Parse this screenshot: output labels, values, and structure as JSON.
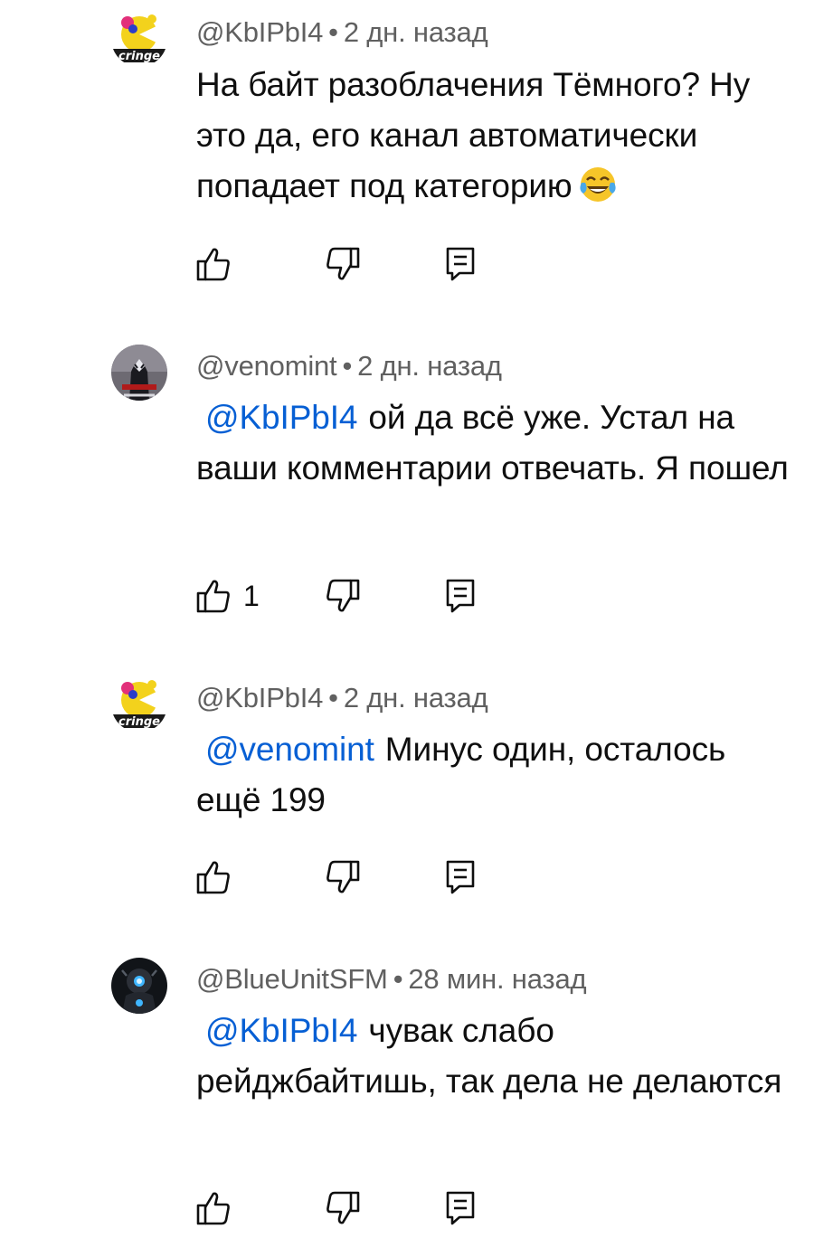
{
  "comments": [
    {
      "author": "@KbIPbI4",
      "time": "2 дн. назад",
      "mention": "",
      "text": "На байт разоблачения Тёмного? Ну это да, его канал автоматически попадает под категорию",
      "emoji_icon": "face-with-tears-of-joy-icon",
      "likes": "",
      "avatar_icon": "cringe-avatar-icon"
    },
    {
      "author": "@venomint",
      "time": "2 дн. назад",
      "mention": "@KbIPbI4",
      "text": "ой да всё уже. Устал на ваши комментарии отвечать. Я пошел",
      "likes": "1",
      "avatar_icon": "venom-avatar-icon"
    },
    {
      "author": "@KbIPbI4",
      "time": "2 дн. назад",
      "mention": "@venomint",
      "text": "Минус один, осталось ещё 199",
      "likes": "",
      "avatar_icon": "cringe-avatar-icon"
    },
    {
      "author": "@BlueUnitSFM",
      "time": "28 мин. назад",
      "mention": "@KbIPbI4",
      "text": "чувак слабо рейджбайтишь, так дела не делаются",
      "likes": "",
      "avatar_icon": "robot-avatar-icon"
    }
  ],
  "icons": {
    "like": "thumbs-up-icon",
    "dislike": "thumbs-down-icon",
    "reply": "reply-comment-icon"
  },
  "colors": {
    "mention": "#065fd4",
    "meta": "#606060",
    "text": "#0f0f0f"
  }
}
